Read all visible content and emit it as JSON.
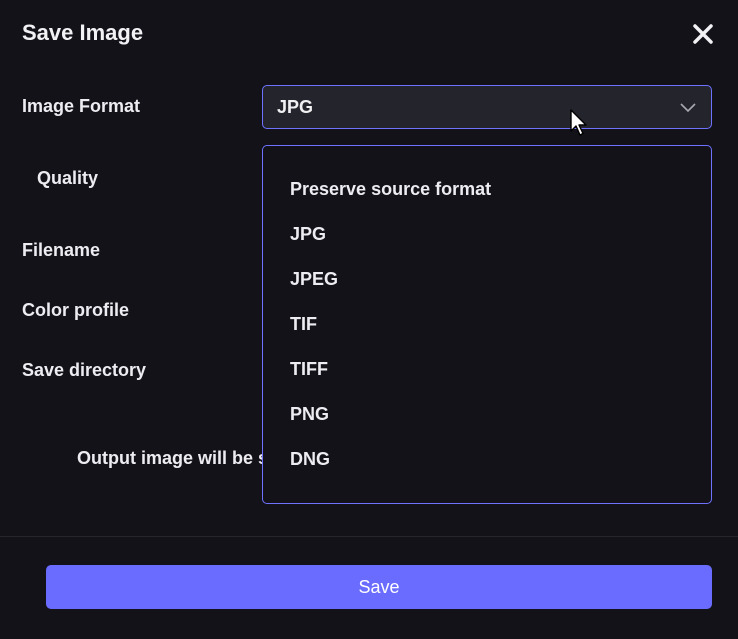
{
  "dialog": {
    "title": "Save Image",
    "close_icon": "close-icon"
  },
  "form": {
    "image_format_label": "Image Format",
    "quality_label": "Quality",
    "filename_label": "Filename",
    "color_profile_label": "Color profile",
    "save_directory_label": "Save directory",
    "output_text": "Output image will be s"
  },
  "format_select": {
    "selected": "JPG",
    "chevron_icon": "chevron-down-icon",
    "options": [
      "Preserve source format",
      "JPG",
      "JPEG",
      "TIF",
      "TIFF",
      "PNG",
      "DNG"
    ]
  },
  "footer": {
    "save_label": "Save"
  },
  "colors": {
    "accent": "#6a6cff",
    "background": "#121218",
    "select_background": "#24242c"
  }
}
